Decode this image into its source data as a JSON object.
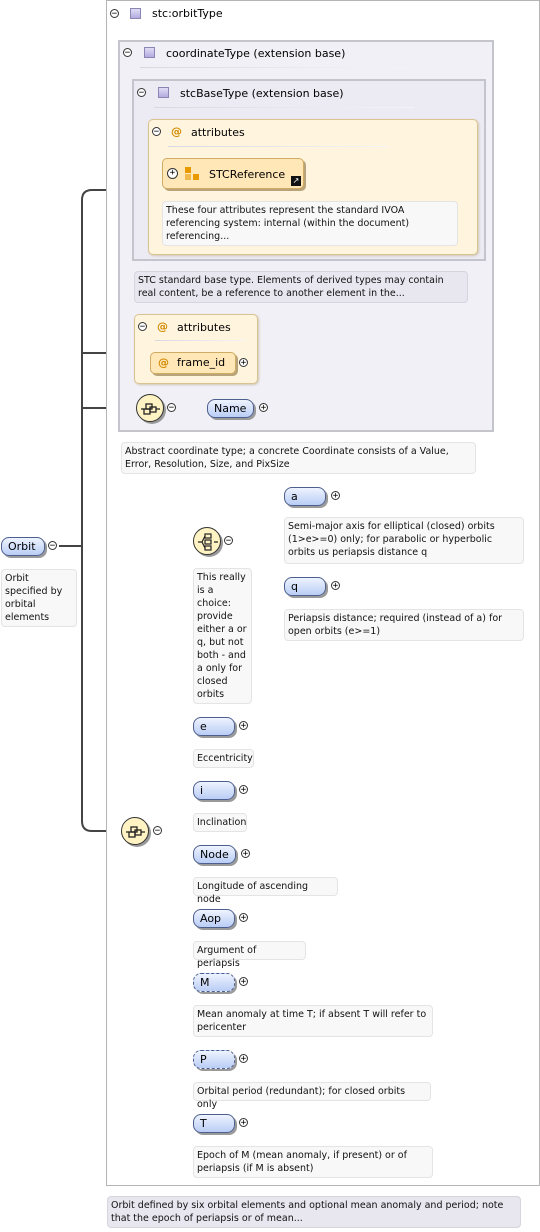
{
  "diagram": {
    "root": {
      "label": "Orbit",
      "note": "Orbit\nspecified by\norbital\nelements"
    },
    "orbit_type": {
      "title": "stc:orbitType",
      "note": "Orbit defined by six orbital elements and optional mean anomaly and period; note\nthat the epoch of periapsis or of mean..."
    },
    "coordinate_type": {
      "title": "coordinateType (extension base)",
      "note": "Abstract coordinate type; a concrete Coordinate consists of a Value,\nError, Resolution, Size, and PixSize",
      "attributes_label": "attributes",
      "frame_id": "frame_id",
      "name": "Name"
    },
    "stc_base_type": {
      "title": "stcBaseType (extension base)",
      "note": "STC standard base type. Elements of derived types may contain\nreal content, be a reference to another element in the...",
      "attributes_label": "attributes",
      "stc_reference": "STCReference",
      "stc_reference_note": "These four attributes represent the standard IVOA\nreferencing system: internal (within the document)\nreferencing..."
    },
    "choice": {
      "note": "This really\nis a\nchoice:\nprovide\neither a or\nq, but not\nboth - and\na only for\nclosed\norbits",
      "a": {
        "label": "a",
        "note": "Semi-major axis for elliptical (closed) orbits\n(1>e>=0) only; for parabolic or hyperbolic\norbits us periapsis distance q"
      },
      "q": {
        "label": "q",
        "note": "Periapsis distance; required (instead of a) for\nopen orbits (e>=1)"
      }
    },
    "sequence": [
      {
        "label": "e",
        "note": "Eccentricity",
        "required": true
      },
      {
        "label": "i",
        "note": "Inclination",
        "required": true
      },
      {
        "label": "Node",
        "note": "Longitude of ascending node",
        "required": true
      },
      {
        "label": "Aop",
        "note": "Argument of periapsis",
        "required": true
      },
      {
        "label": "M",
        "note": "Mean anomaly at time T; if absent T will refer to\npericenter",
        "required": false
      },
      {
        "label": "P",
        "note": "Orbital period (redundant); for closed orbits only",
        "required": false
      },
      {
        "label": "T",
        "note": "Epoch of M (mean anomaly, if present) or of\nperiapsis (if M is absent)",
        "required": true
      }
    ],
    "icons": {
      "collapse": "minus-circle-icon",
      "expand": "plus-circle-icon",
      "sequence": "sequence-compositor-icon",
      "choice": "choice-compositor-icon",
      "attribute": "at-sign-icon",
      "type": "complex-type-icon",
      "attribute_group": "attribute-group-icon",
      "link": "shortcut-arrow-icon"
    },
    "colors": {
      "element_fill": "#b9cdf5",
      "attribute_fill": "#ffe7b8",
      "type_box": "#eceaf3",
      "connector": "#444444"
    }
  }
}
